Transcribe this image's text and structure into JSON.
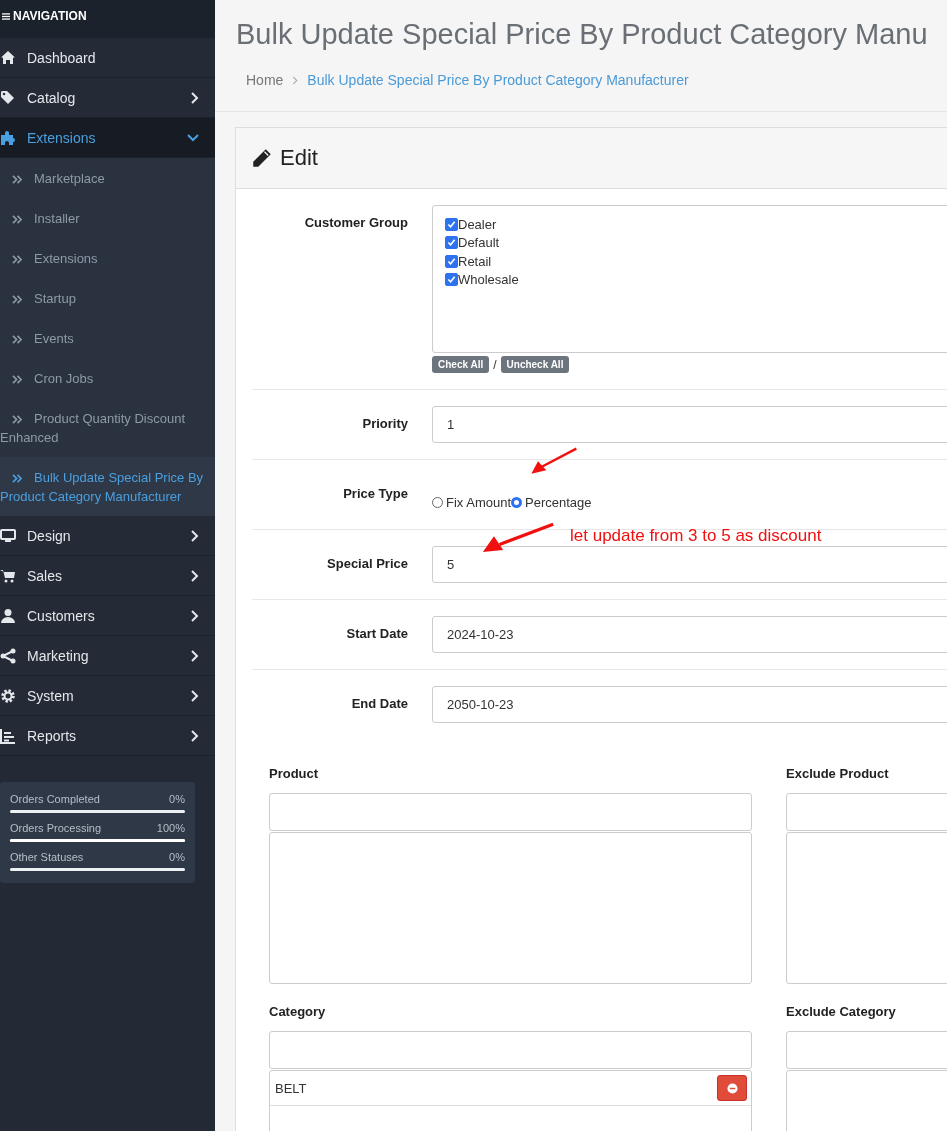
{
  "sidebar": {
    "header": "NAVIGATION",
    "items": [
      {
        "label": "Dashboard",
        "selected": false
      },
      {
        "label": "Catalog",
        "selected": false,
        "expanded": false
      },
      {
        "label": "Extensions",
        "selected": true,
        "expanded": true,
        "children": [
          {
            "label": "Marketplace",
            "selected": false
          },
          {
            "label": "Installer",
            "selected": false
          },
          {
            "label": "Extensions",
            "selected": false
          },
          {
            "label": "Startup",
            "selected": false
          },
          {
            "label": "Events",
            "selected": false
          },
          {
            "label": "Cron Jobs",
            "selected": false
          },
          {
            "label": "Product Quantity Discount Enhanced",
            "selected": false
          },
          {
            "label": "Bulk Update Special Price By Product Category Manufacturer",
            "selected": true
          }
        ]
      },
      {
        "label": "Design",
        "selected": false,
        "expanded": false
      },
      {
        "label": "Sales",
        "selected": false,
        "expanded": false
      },
      {
        "label": "Customers",
        "selected": false,
        "expanded": false
      },
      {
        "label": "Marketing",
        "selected": false,
        "expanded": false
      },
      {
        "label": "System",
        "selected": false,
        "expanded": false
      },
      {
        "label": "Reports",
        "selected": false,
        "expanded": false
      }
    ],
    "stats": [
      {
        "label": "Orders Completed",
        "value": "0%",
        "level": 0
      },
      {
        "label": "Orders Processing",
        "value": "100%",
        "level": 1
      },
      {
        "label": "Other Statuses",
        "value": "0%",
        "level": 0
      }
    ]
  },
  "page": {
    "title": "Bulk Update Special Price By Product Category Manu",
    "breadcrumb": [
      {
        "label": "Home"
      },
      {
        "label": "Bulk Update Special Price By Product Category Manufacturer"
      }
    ]
  },
  "panel": {
    "heading": "Edit",
    "fields": [
      {
        "kind": "checklist",
        "label": "Customer Group",
        "options": [
          {
            "label": "Dealer",
            "checked": true
          },
          {
            "label": "Default",
            "checked": true
          },
          {
            "label": "Retail",
            "checked": true
          },
          {
            "label": "Wholesale",
            "checked": true
          }
        ],
        "buttons": [
          "Check All",
          "Uncheck All"
        ],
        "separator": "/"
      },
      {
        "kind": "text",
        "label": "Priority",
        "value": "1"
      },
      {
        "kind": "radio",
        "label": "Price Type",
        "options": [
          {
            "label": "Fix Amount",
            "selected": false
          },
          {
            "label": "Percentage",
            "selected": true
          }
        ]
      },
      {
        "kind": "text",
        "label": "Special Price",
        "value": "5"
      },
      {
        "kind": "text",
        "label": "Start Date",
        "value": "2024-10-23"
      },
      {
        "kind": "text",
        "label": "End Date",
        "value": "2050-10-23"
      }
    ],
    "pickers": [
      {
        "label": "Product"
      },
      {
        "label": "Exclude Product"
      },
      {
        "label": "Category",
        "items": [
          {
            "label": "BELT"
          }
        ]
      },
      {
        "label": "Exclude Category"
      }
    ]
  },
  "annotations": [
    {
      "text": "let update from 3 to 5 as discount"
    }
  ]
}
